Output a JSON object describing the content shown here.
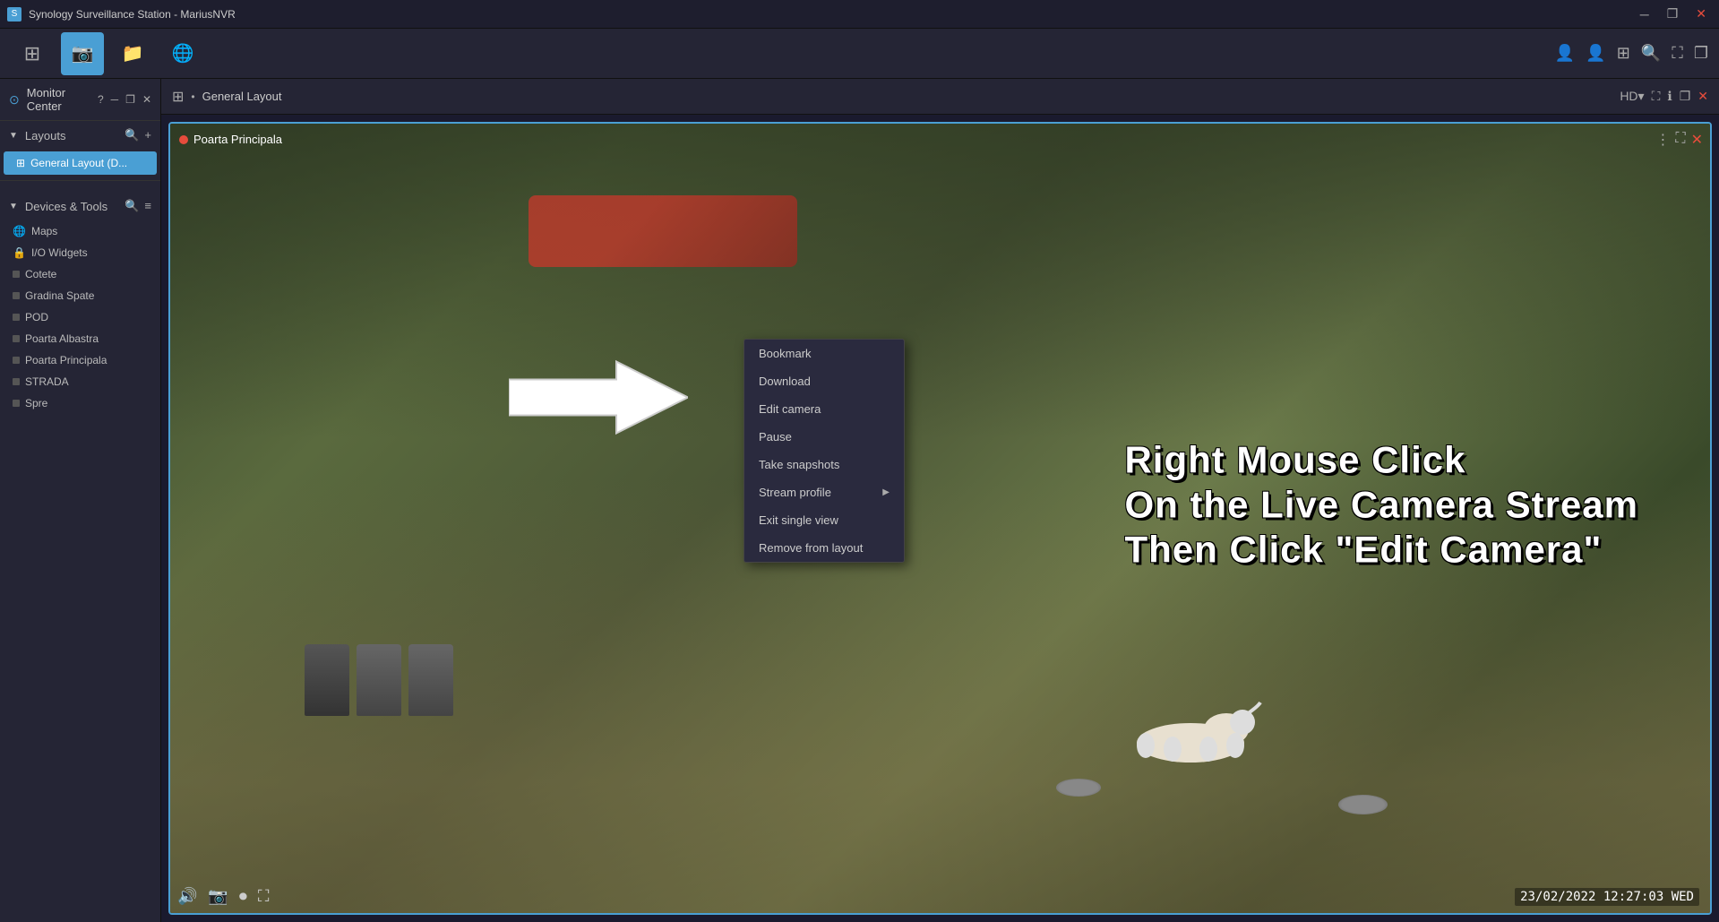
{
  "titlebar": {
    "title": "Synology Surveillance Station - MariusNVR",
    "icon": "🎥"
  },
  "toolbar": {
    "buttons": [
      {
        "id": "grid",
        "label": "⊞",
        "active": false
      },
      {
        "id": "monitor",
        "label": "📷",
        "active": true
      },
      {
        "id": "folder",
        "label": "📁",
        "active": false
      },
      {
        "id": "network",
        "label": "🌐",
        "active": false
      }
    ],
    "right_icons": [
      "👤",
      "👤",
      "⊞",
      "🔍",
      "⛶",
      "❐"
    ]
  },
  "monitor_center": {
    "title": "Monitor Center"
  },
  "layouts": {
    "section_title": "Layouts",
    "items": [
      {
        "id": "general",
        "label": "General Layout (D...",
        "active": true
      }
    ]
  },
  "layout_header": {
    "title": "General Layout",
    "grid_icon": "⊞"
  },
  "camera": {
    "name": "Poarta Principala",
    "timestamp": "23/02/2022  12:27:03  WED",
    "overlay_lines": [
      "Right Mouse Click",
      "On the Live Camera Stream",
      "Then Click \"Edit Camera\""
    ]
  },
  "context_menu": {
    "items": [
      {
        "id": "bookmark",
        "label": "Bookmark",
        "has_submenu": false
      },
      {
        "id": "download",
        "label": "Download",
        "has_submenu": false
      },
      {
        "id": "edit-camera",
        "label": "Edit camera",
        "has_submenu": false
      },
      {
        "id": "pause",
        "label": "Pause",
        "has_submenu": false
      },
      {
        "id": "take-snapshots",
        "label": "Take snapshots",
        "has_submenu": false
      },
      {
        "id": "stream-profile",
        "label": "Stream profile",
        "has_submenu": true
      },
      {
        "id": "exit-single-view",
        "label": "Exit single view",
        "has_submenu": false
      },
      {
        "id": "remove-from-layout",
        "label": "Remove from layout",
        "has_submenu": false
      }
    ]
  },
  "devices_tools": {
    "section_title": "Devices & Tools",
    "items": [
      {
        "id": "maps",
        "label": "Maps",
        "icon": "🌐"
      },
      {
        "id": "io-widgets",
        "label": "I/O Widgets",
        "icon": "🔒"
      },
      {
        "id": "cotete",
        "label": "Cotete",
        "icon": "📷"
      },
      {
        "id": "gradina-spate",
        "label": "Gradina Spate",
        "icon": "📷"
      },
      {
        "id": "pod",
        "label": "POD",
        "icon": "📷"
      },
      {
        "id": "poarta-albastra",
        "label": "Poarta Albastra",
        "icon": "📷"
      },
      {
        "id": "poarta-principala",
        "label": "Poarta Principala",
        "icon": "📷"
      },
      {
        "id": "strada",
        "label": "STRADA",
        "icon": "📷"
      },
      {
        "id": "spre",
        "label": "Spre",
        "icon": "📷"
      }
    ]
  }
}
